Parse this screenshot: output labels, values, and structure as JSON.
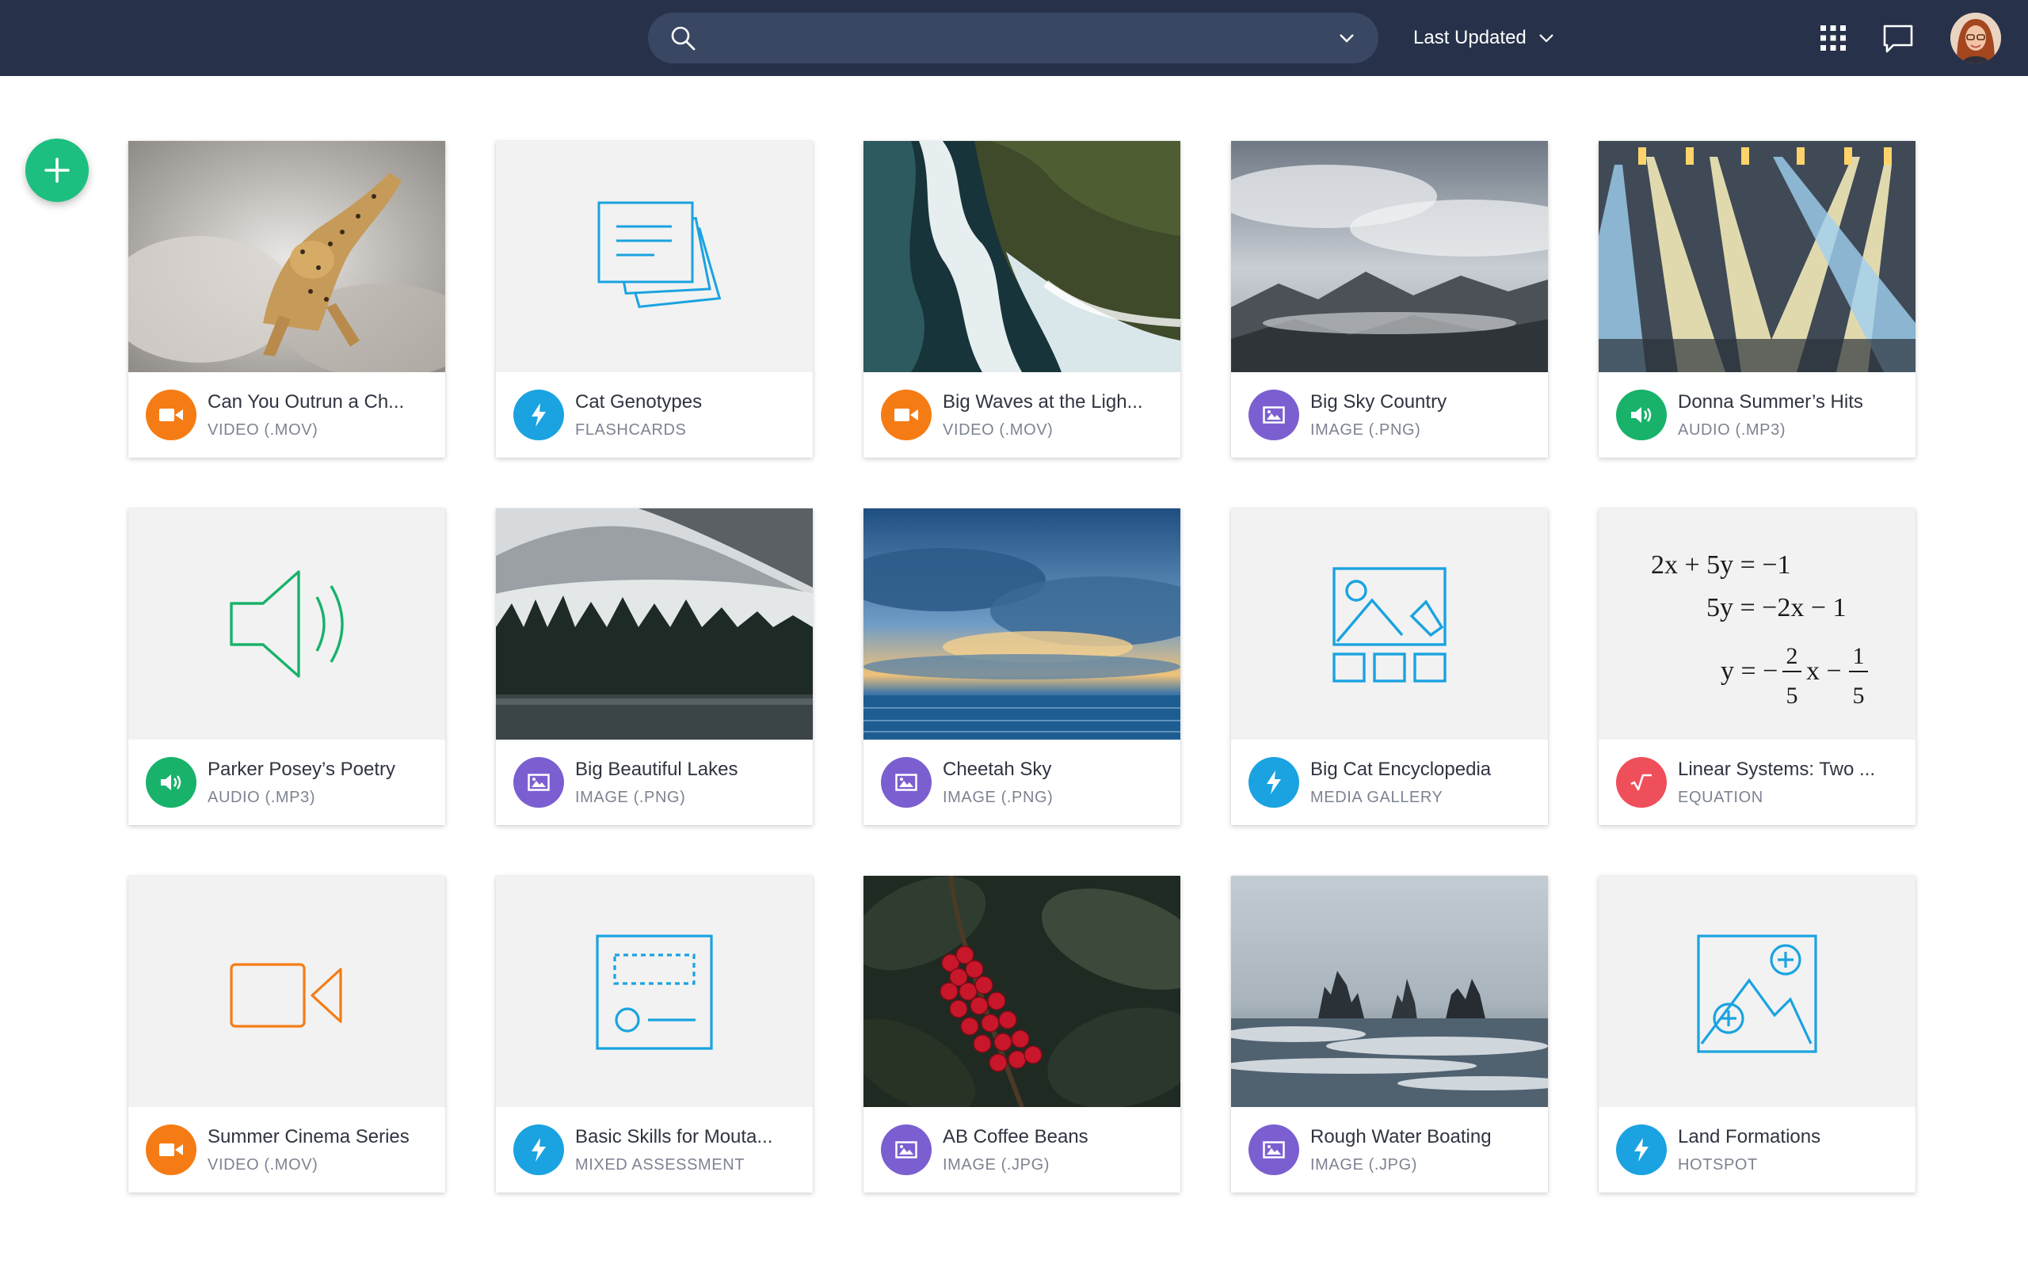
{
  "header": {
    "search_placeholder": "",
    "sort_label": "Last Updated",
    "colors": {
      "bar": "#27324a",
      "search": "#3a4763"
    }
  },
  "fab": {
    "icon": "plus-icon",
    "color": "#1dbf80"
  },
  "badge_colors": {
    "video": "#f57c14",
    "flashcards": "#1aa3e0",
    "image": "#7b5fd1",
    "audio": "#18b26b",
    "equation": "#ef4f5a"
  },
  "cards": [
    {
      "title": "Can You Outrun a Ch...",
      "type": "VIDEO (.MOV)",
      "badge": "video-camera-icon"
    },
    {
      "title": "Cat Genotypes",
      "type": "FLASHCARDS",
      "badge": "lightning-icon"
    },
    {
      "title": "Big Waves at the Ligh...",
      "type": "VIDEO (.MOV)",
      "badge": "video-camera-icon"
    },
    {
      "title": "Big Sky Country",
      "type": "IMAGE (.PNG)",
      "badge": "image-icon"
    },
    {
      "title": "Donna Summer’s Hits",
      "type": "AUDIO (.MP3)",
      "badge": "speaker-icon"
    },
    {
      "title": "Parker Posey’s Poetry",
      "type": "AUDIO (.MP3)",
      "badge": "speaker-icon"
    },
    {
      "title": "Big Beautiful Lakes",
      "type": "IMAGE (.PNG)",
      "badge": "image-icon"
    },
    {
      "title": "Cheetah Sky",
      "type": "IMAGE (.PNG)",
      "badge": "image-icon"
    },
    {
      "title": "Big Cat Encyclopedia",
      "type": "MEDIA GALLERY",
      "badge": "lightning-icon"
    },
    {
      "title": "Linear Systems: Two ...",
      "type": "EQUATION",
      "badge": "square-root-icon"
    },
    {
      "title": "Summer Cinema Series",
      "type": "VIDEO (.MOV)",
      "badge": "video-camera-icon"
    },
    {
      "title": "Basic Skills for Mouta...",
      "type": "MIXED ASSESSMENT",
      "badge": "lightning-icon"
    },
    {
      "title": "AB Coffee Beans",
      "type": "IMAGE (.JPG)",
      "badge": "image-icon"
    },
    {
      "title": "Rough Water Boating",
      "type": "IMAGE (.JPG)",
      "badge": "image-icon"
    },
    {
      "title": "Land Formations",
      "type": "HOTSPOT",
      "badge": "lightning-icon"
    }
  ],
  "equation": {
    "line1": "2x + 5y = −1",
    "line2": "5y = −2x − 1",
    "line3_lhs": "y = −",
    "frac1_num": "2",
    "frac1_den": "5",
    "line3_mid": "x −",
    "frac2_num": "1",
    "frac2_den": "5"
  }
}
